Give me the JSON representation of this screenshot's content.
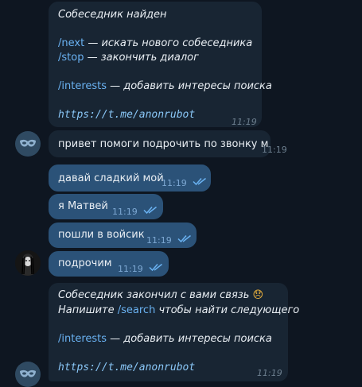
{
  "msg1": {
    "title": "Собеседник найден",
    "cmd_next": "/next",
    "next_desc": " — искать нового собеседника",
    "cmd_stop": "/stop",
    "stop_desc": " — закончить диалог",
    "cmd_interests": "/interests",
    "interests_desc": " — добавить интересы поиска",
    "link": "https://t.me/anonrubot",
    "time": "11:19"
  },
  "msg2": {
    "text": "привет помоги подрочить по звонку м",
    "time": "11:19"
  },
  "msg3": {
    "text": "давай сладкий мой",
    "time": "11:19"
  },
  "msg4": {
    "text": "я Матвей",
    "time": "11:19"
  },
  "msg5": {
    "text": "пошли в войсик",
    "time": "11:19"
  },
  "msg6": {
    "text": "подрочим",
    "time": "11:19"
  },
  "msg7": {
    "line1": "Собеседник закончил с вами связь",
    "emoji": "😞",
    "line2_pre": "Напишите ",
    "cmd_search": "/search",
    "line2_post": " чтобы найти следующего",
    "cmd_interests": "/interests",
    "interests_desc": " — добавить интересы поиска",
    "link": "https://t.me/anonrubot",
    "time": "11:19"
  },
  "icons": {
    "bot_avatar": "mask-icon",
    "user_avatar": "photo-avatar",
    "read": "double-check-icon"
  }
}
